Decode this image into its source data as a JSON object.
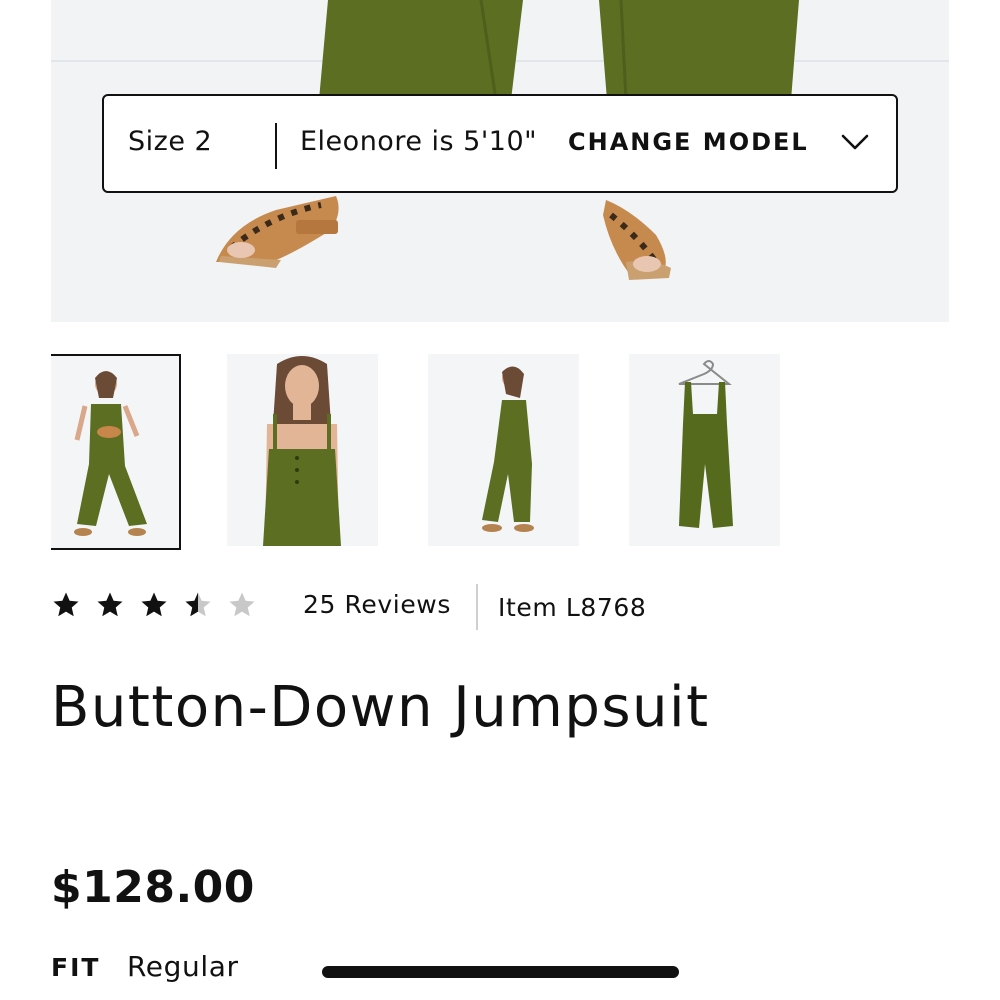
{
  "model_selector": {
    "size": "Size 2",
    "model_info": "Eleonore is 5'10\"",
    "change_label": "CHANGE MODEL"
  },
  "gallery": {
    "selected_index": 0,
    "thumbnail_count": 4
  },
  "rating": {
    "value": 3.5,
    "max": 5,
    "reviews_label": "25 Reviews",
    "item_label": "Item L8768"
  },
  "product": {
    "title": "Button-Down Jumpsuit",
    "price": "$128.00",
    "fit_label": "FIT",
    "fit_value": "Regular"
  },
  "colors": {
    "garment_green": "#5b6e22",
    "text": "#111111",
    "star_empty": "#c8c8c8"
  },
  "icons": {
    "change_model": "chevron-down-icon",
    "rating": "star-icon"
  }
}
